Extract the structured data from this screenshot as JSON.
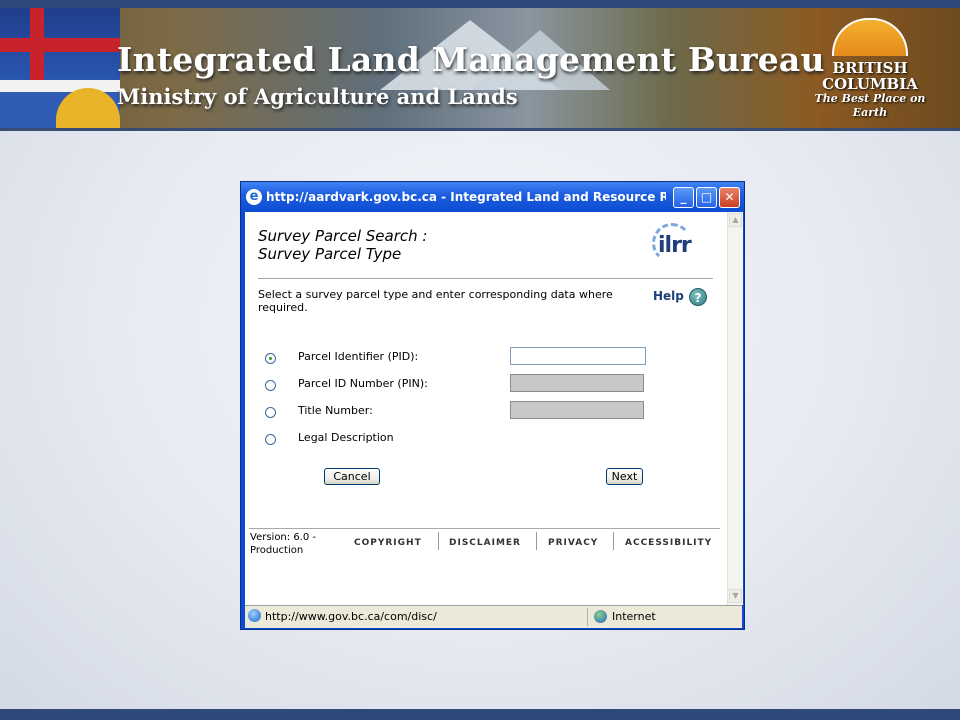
{
  "banner": {
    "title": "Integrated Land Management Bureau",
    "subtitle": "Ministry of Agriculture and Lands",
    "bc_line1": "BRITISH",
    "bc_line2": "COLUMBIA",
    "bc_tagline": "The Best Place on Earth"
  },
  "window": {
    "title": "http://aardvark.gov.bc.ca - Integrated Land and Resource Reg...",
    "icon": "ie-icon",
    "buttons": {
      "minimize": "_",
      "maximize": "□",
      "close": "✕"
    }
  },
  "page": {
    "heading_line1": "Survey Parcel Search :",
    "heading_line2": "Survey Parcel Type",
    "logo_text": "ilrr",
    "instructions": "Select a survey parcel type and enter corresponding data where required.",
    "help_label": "Help",
    "help_icon": "?",
    "options": [
      {
        "label": "Parcel Identifier (PID):",
        "selected": true,
        "has_input": true,
        "input_enabled": true,
        "value": ""
      },
      {
        "label": "Parcel ID Number (PIN):",
        "selected": false,
        "has_input": true,
        "input_enabled": false,
        "value": ""
      },
      {
        "label": "Title Number:",
        "selected": false,
        "has_input": true,
        "input_enabled": false,
        "value": ""
      },
      {
        "label": "Legal Description",
        "selected": false,
        "has_input": false
      }
    ],
    "cancel_label": "Cancel",
    "next_label": "Next",
    "version_text": "Version: 6.0 - Production",
    "footer_links": [
      "COPYRIGHT",
      "DISCLAIMER",
      "PRIVACY",
      "ACCESSIBILITY"
    ]
  },
  "status": {
    "url": "http://www.gov.bc.ca/com/disc/",
    "zone": "Internet"
  },
  "colors": {
    "titlebar": "#0b4cd2",
    "banner_bar": "#2f4a7a",
    "heading_blue": "#1f3f7a"
  }
}
